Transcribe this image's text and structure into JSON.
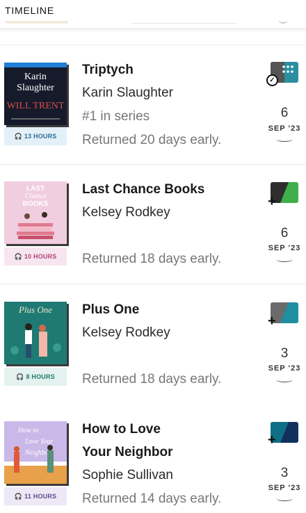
{
  "header": {
    "title": "TIMELINE"
  },
  "items": [
    {
      "title": "Triptych",
      "title_line2": "",
      "author": "Karin Slaughter",
      "series": "#1 in series",
      "returned": "Returned 20 days early.",
      "hours": "13 HOURS",
      "day": "6",
      "month": "SEP '23",
      "cover_text": {
        "top": "Karin",
        "mid": "Slaughter",
        "sub": "WILL TRENT"
      },
      "status_icon": "loan-check-icon",
      "colors": {
        "cover_bg": "#141a2a",
        "hours_bg": "#e4f0f7",
        "hours_fg": "#2a6f9a",
        "status_a": "#555555",
        "status_b": "#2a8fa0"
      }
    },
    {
      "title": "Last Chance Books",
      "title_line2": "",
      "author": "Kelsey Rodkey",
      "series": "",
      "returned": "Returned 18 days early.",
      "hours": "10 HOURS",
      "day": "6",
      "month": "SEP '23",
      "cover_text": {
        "top": "LAST",
        "mid": "Chance",
        "sub": "BOOKS"
      },
      "status_icon": "add-plus-icon",
      "colors": {
        "cover_bg": "#f1cde0",
        "hours_bg": "#f7e6ef",
        "hours_fg": "#b0457a",
        "status_a": "#2e2e2e",
        "status_b": "#3fae4a"
      }
    },
    {
      "title": "Plus One",
      "title_line2": "",
      "author": "Kelsey Rodkey",
      "series": "",
      "returned": "Returned 18 days early.",
      "hours": "8 HOURS",
      "day": "3",
      "month": "SEP '23",
      "cover_text": {
        "top": "Plus One",
        "mid": "",
        "sub": ""
      },
      "status_icon": "add-plus-icon",
      "colors": {
        "cover_bg": "#1f7a74",
        "hours_bg": "#e3f2ef",
        "hours_fg": "#1f7a6a",
        "status_a": "#6b6b6b",
        "status_b": "#1e8ea0"
      }
    },
    {
      "title": "How to Love",
      "title_line2": "Your Neighbor",
      "author": "Sophie Sullivan",
      "series": "",
      "returned": "Returned 14 days early.",
      "hours": "11 HOURS",
      "day": "3",
      "month": "SEP '23",
      "cover_text": {
        "top": "How to",
        "mid": "Love Your",
        "sub": "Neighbor"
      },
      "status_icon": "add-plus-icon",
      "colors": {
        "cover_bg": "#c9b8e8",
        "hours_bg": "#ece8f5",
        "hours_fg": "#5a4f8f",
        "status_a": "#0f6f86",
        "status_b": "#12305e"
      }
    }
  ]
}
